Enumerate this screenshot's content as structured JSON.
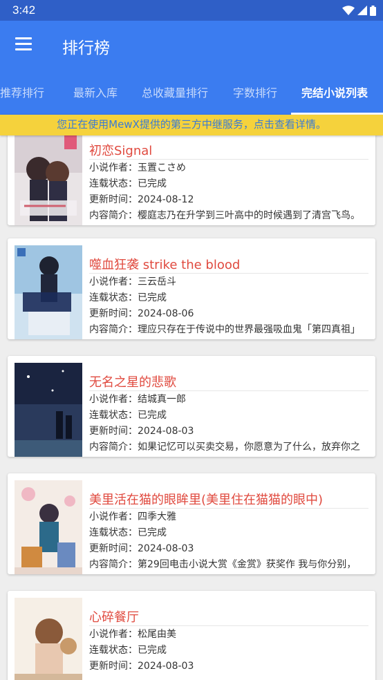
{
  "status_bar": {
    "time": "3:42"
  },
  "app_bar": {
    "title": "排行榜"
  },
  "tabs": [
    {
      "label": "日推荐排行"
    },
    {
      "label": "最新入库"
    },
    {
      "label": "总收藏量排行"
    },
    {
      "label": "字数排行"
    },
    {
      "label": "完结小说列表"
    }
  ],
  "notice": "您正在使用MewX提供的第三方中继服务，点击查看详情。",
  "labels": {
    "author": "小说作者：",
    "status": "连载状态：",
    "updated": "更新时间：",
    "intro": "内容简介："
  },
  "books": [
    {
      "title": "初恋Signal",
      "author": "玉置こさめ",
      "status": "已完成",
      "updated": "2024-08-12",
      "intro": "樱庭志乃在升学到三叶高中的时候遇到了清宫飞鸟。"
    },
    {
      "title": "噬血狂袭 strike the blood",
      "author": "三云岳斗",
      "status": "已完成",
      "updated": "2024-08-06",
      "intro": "理应只存在于传说中的世界最强吸血鬼「第四真祖」"
    },
    {
      "title": "无名之星的悲歌",
      "author": "结城真一郎",
      "status": "已完成",
      "updated": "2024-08-03",
      "intro": "如果记忆可以买卖交易，你愿意为了什么，放弃你之"
    },
    {
      "title": "美里活在猫的眼眸里(美里住在猫猫的眼中)",
      "author": "四季大雅",
      "status": "已完成",
      "updated": "2024-08-03",
      "intro": "第29回电击小说大赏《金赏》获奖作 我与你分别，"
    },
    {
      "title": "心碎餐厅",
      "author": "松尾由美",
      "status": "已完成",
      "updated": "2024-08-03",
      "intro": ""
    }
  ],
  "colors": {
    "status_bar": "#2f5fc7",
    "app_bar": "#3b7cf0",
    "notice_bg": "#f5d23c",
    "notice_text": "#3a7bd5",
    "title_red": "#e04a3f"
  }
}
